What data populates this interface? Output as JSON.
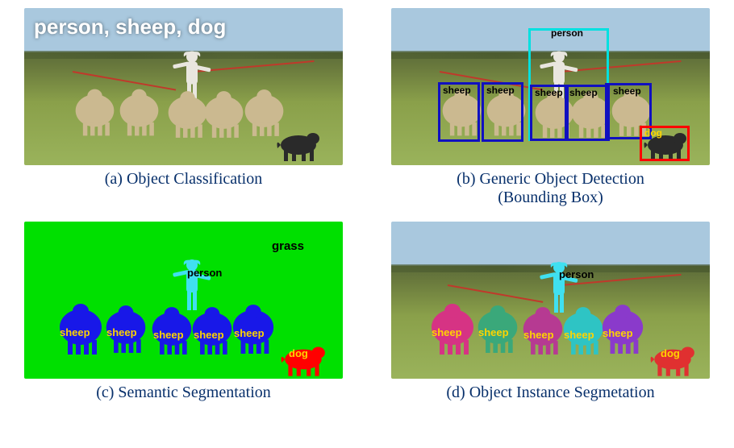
{
  "panels": {
    "a": {
      "caption": "(a) Object Classification",
      "overlay_text": "person, sheep, dog"
    },
    "b": {
      "caption_line1": "(b) Generic Object Detection",
      "caption_line2": "(Bounding Box)",
      "boxes": {
        "person": {
          "label": "person",
          "color": "#00e0e0"
        },
        "sheep1": {
          "label": "sheep",
          "color": "#1010c0"
        },
        "sheep2": {
          "label": "sheep",
          "color": "#1010c0"
        },
        "sheep3": {
          "label": "sheep",
          "color": "#1010c0"
        },
        "sheep4": {
          "label": "sheep",
          "color": "#1010c0"
        },
        "sheep5": {
          "label": "sheep",
          "color": "#1010c0"
        },
        "dog": {
          "label": "dog",
          "color": "#ff0000"
        }
      }
    },
    "c": {
      "caption": "(c) Semantic Segmentation",
      "labels": {
        "grass": "grass",
        "person": "person",
        "sheep1": "sheep",
        "sheep2": "sheep",
        "sheep3": "sheep",
        "sheep4": "sheep",
        "sheep5": "sheep",
        "dog": "dog"
      },
      "colors": {
        "background": "#00e000",
        "sheep": "#1818e8",
        "person": "#40e0f0",
        "dog": "#ff0000"
      }
    },
    "d": {
      "caption": "(d) Object Instance Segmetation",
      "labels": {
        "person": "person",
        "sheep1": "sheep",
        "sheep2": "sheep",
        "sheep3": "sheep",
        "sheep4": "sheep",
        "sheep5": "sheep",
        "dog": "dog"
      },
      "colors": {
        "person": "#40e0f0",
        "sheep1": "#d63384",
        "sheep2": "#3aa87a",
        "sheep3": "#b63a92",
        "sheep4": "#2ec4c4",
        "sheep5": "#8a3acb",
        "dog": "#e03030"
      }
    }
  }
}
